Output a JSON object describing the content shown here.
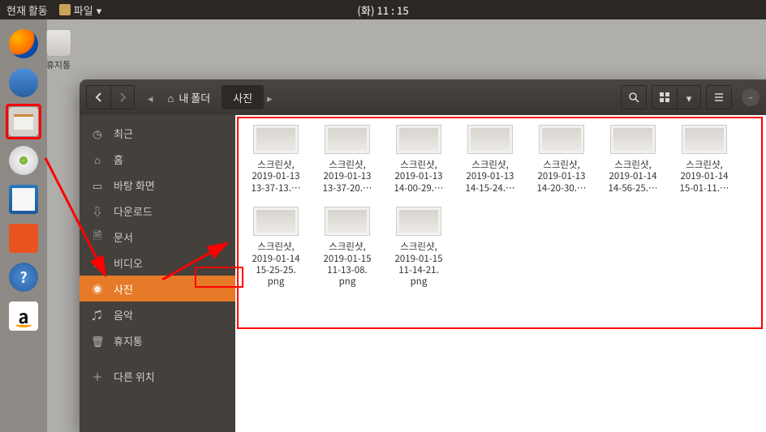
{
  "topbar": {
    "activities": "현재 활동",
    "app_name": "파일",
    "clock": "(화)  11 : 15"
  },
  "trash_label": "휴지통",
  "dock": [
    {
      "name": "firefox"
    },
    {
      "name": "thunderbird"
    },
    {
      "name": "files"
    },
    {
      "name": "sound"
    },
    {
      "name": "libre"
    },
    {
      "name": "soft"
    },
    {
      "name": "help"
    },
    {
      "name": "amazon"
    }
  ],
  "path": {
    "root": "내 폴더",
    "current": "사진"
  },
  "sidebar": [
    {
      "icon": "◷",
      "label": "최근",
      "name": "recent"
    },
    {
      "icon": "⌂",
      "label": "홈",
      "name": "home"
    },
    {
      "icon": "▭",
      "label": "바탕 화면",
      "name": "desktop"
    },
    {
      "icon": "⇩",
      "label": "다운로드",
      "name": "downloads"
    },
    {
      "icon": "🗎",
      "label": "문서",
      "name": "documents"
    },
    {
      "icon": "▸",
      "label": "비디오",
      "name": "videos"
    },
    {
      "icon": "◉",
      "label": "사진",
      "name": "pictures",
      "active": true
    },
    {
      "icon": "♫",
      "label": "음악",
      "name": "music"
    },
    {
      "icon": "🗑",
      "label": "휴지통",
      "name": "trash"
    },
    {
      "icon": "＋",
      "label": "다른 위치",
      "name": "other"
    }
  ],
  "files": [
    {
      "line1": "스크린샷,",
      "line2": "2019-01-13",
      "line3": "13-37-13.…"
    },
    {
      "line1": "스크린샷,",
      "line2": "2019-01-13",
      "line3": "13-37-20.…"
    },
    {
      "line1": "스크린샷,",
      "line2": "2019-01-13",
      "line3": "14-00-29.…"
    },
    {
      "line1": "스크린샷,",
      "line2": "2019-01-13",
      "line3": "14-15-24.…"
    },
    {
      "line1": "스크린샷,",
      "line2": "2019-01-13",
      "line3": "14-20-30.…"
    },
    {
      "line1": "스크린샷,",
      "line2": "2019-01-14",
      "line3": "14-56-25.…"
    },
    {
      "line1": "스크린샷,",
      "line2": "2019-01-14",
      "line3": "15-01-11.…"
    },
    {
      "line1": "스크린샷,",
      "line2": "2019-01-14",
      "line3": "15-25-25.",
      "line4": "png"
    },
    {
      "line1": "스크린샷,",
      "line2": "2019-01-15",
      "line3": "11-13-08.",
      "line4": "png"
    },
    {
      "line1": "스크린샷,",
      "line2": "2019-01-15",
      "line3": "11-14-21.",
      "line4": "png"
    }
  ]
}
